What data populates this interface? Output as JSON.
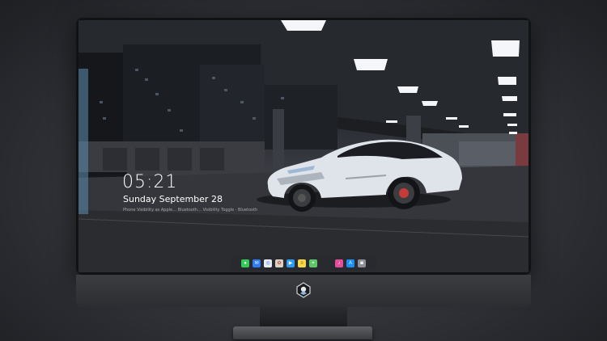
{
  "lockscreen": {
    "time": "05:21",
    "date": "Sunday September  28",
    "subtitle": "Phone Visibility as Apple… Bluetooth… Visibility Toggle · Bluetooth"
  },
  "dock": {
    "items": [
      {
        "name": "messages-icon",
        "color": "#35c759"
      },
      {
        "name": "mail-icon",
        "color": "#2f7cf6"
      },
      {
        "name": "safari-icon",
        "color": "#e9edf2"
      },
      {
        "name": "photos-icon",
        "color": "#d9d2c3"
      },
      {
        "name": "clapper-icon",
        "color": "#2d9bf0"
      },
      {
        "name": "notes-icon",
        "color": "#f6d64a"
      },
      {
        "name": "maps-icon",
        "color": "#5ec56b"
      },
      {
        "name": "music-icon",
        "color": "#e54c9a"
      },
      {
        "name": "app-store-icon",
        "color": "#1b8ef5"
      },
      {
        "name": "camera-icon",
        "color": "#8c9096"
      }
    ]
  },
  "colors": {
    "car_body": "#dfe3ea",
    "ceiling_light": "#f4f6fa",
    "accent_blue": "#2f7cf6"
  }
}
